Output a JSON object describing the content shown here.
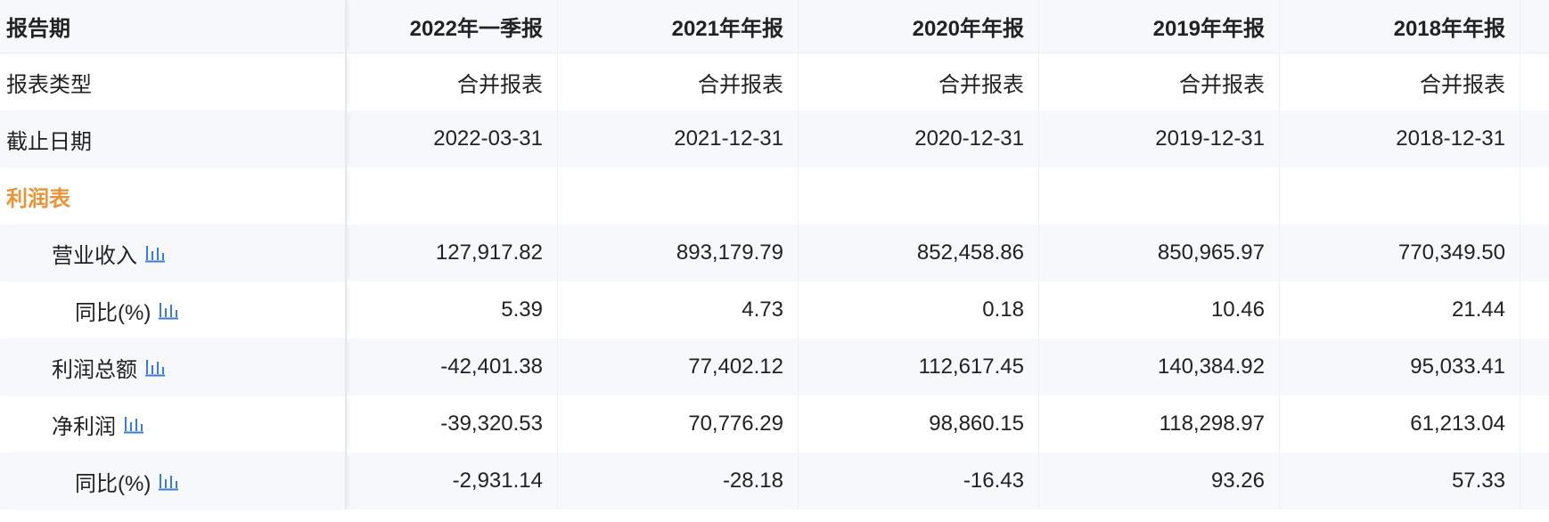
{
  "header": {
    "label": "报告期",
    "periods": [
      "2022年一季报",
      "2021年年报",
      "2020年年报",
      "2019年年报",
      "2018年年报"
    ]
  },
  "rows": [
    {
      "label": "报表类型",
      "values": [
        "合并报表",
        "合并报表",
        "合并报表",
        "合并报表",
        "合并报表"
      ]
    },
    {
      "label": "截止日期",
      "values": [
        "2022-03-31",
        "2021-12-31",
        "2020-12-31",
        "2019-12-31",
        "2018-12-31"
      ]
    },
    {
      "label": "利润表",
      "values": [
        "",
        "",
        "",
        "",
        ""
      ]
    },
    {
      "label": "营业收入",
      "values": [
        "127,917.82",
        "893,179.79",
        "852,458.86",
        "850,965.97",
        "770,349.50"
      ]
    },
    {
      "label": "同比(%)",
      "values": [
        "5.39",
        "4.73",
        "0.18",
        "10.46",
        "21.44"
      ]
    },
    {
      "label": "利润总额",
      "values": [
        "-42,401.38",
        "77,402.12",
        "112,617.45",
        "140,384.92",
        "95,033.41"
      ]
    },
    {
      "label": "净利润",
      "values": [
        "-39,320.53",
        "70,776.29",
        "98,860.15",
        "118,298.97",
        "61,213.04"
      ]
    },
    {
      "label": "同比(%)",
      "values": [
        "-2,931.14",
        "-28.18",
        "-16.43",
        "93.26",
        "57.33"
      ]
    }
  ],
  "icons": {
    "chart": "bar-chart-icon"
  },
  "colors": {
    "section_title": "#e8943a",
    "icon_blue": "#3a7bd5",
    "row_shade": "#f7f8fc"
  }
}
